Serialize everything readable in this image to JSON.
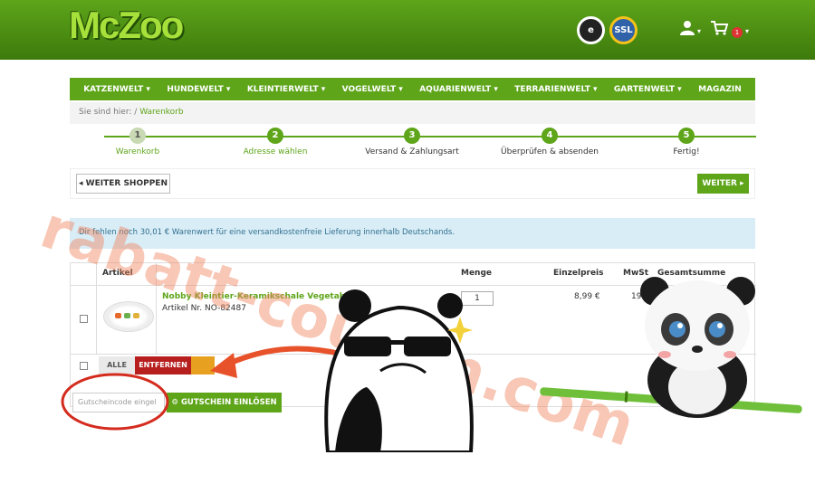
{
  "header": {
    "logo": "McZoo",
    "seal_trusted": "e",
    "seal_ssl": "SSL",
    "user_icon": "user-icon",
    "cart_icon": "cart-icon",
    "cart_count": "1"
  },
  "nav": {
    "items": [
      "KATZENWELT ▾",
      "HUNDEWELT ▾",
      "KLEINTIERWELT ▾",
      "VOGELWELT ▾",
      "AQUARIENWELT ▾",
      "TERRARIENWELT ▾",
      "GARTENWELT ▾",
      "MAGAZIN"
    ]
  },
  "breadcrumb": {
    "prefix": "Sie sind hier:",
    "separator": "/",
    "current": "Warenkorb"
  },
  "steps": [
    {
      "num": "1",
      "label": "Warenkorb"
    },
    {
      "num": "2",
      "label": "Adresse wählen"
    },
    {
      "num": "3",
      "label": "Versand & Zahlungsart"
    },
    {
      "num": "4",
      "label": "Überprüfen & absenden"
    },
    {
      "num": "5",
      "label": "Fertig!"
    }
  ],
  "toolbar": {
    "back_label": "◂ WEITER SHOPPEN",
    "next_label": "WEITER ▸"
  },
  "info": "Dir fehlen noch 30,01 € Warenwert für eine versandkostenfreie Lieferung innerhalb Deutschands.",
  "table": {
    "headers": {
      "article": "Artikel",
      "qty": "Menge",
      "unit_price": "Einzelpreis",
      "vat": "MwSt",
      "total": "Gesamtsumme"
    },
    "row": {
      "name": "Nobby Kleintier-Keramikschale Vegetable",
      "nr": "Artikel Nr. NO-82487",
      "qty": "1",
      "price": "8,99 €",
      "vat": "19"
    }
  },
  "actions": {
    "alle": "ALLE",
    "remove": "ENTFERNEN",
    "coupon_placeholder": "Gutscheincode eingel",
    "coupon_button": "⚙ GUTSCHEIN EINLÖSEN"
  },
  "watermark": "rabatt-coupon.com",
  "colors": {
    "brand_green": "#5ea51a",
    "info_bg": "#d9edf7",
    "remove_red": "#b71f1f"
  }
}
